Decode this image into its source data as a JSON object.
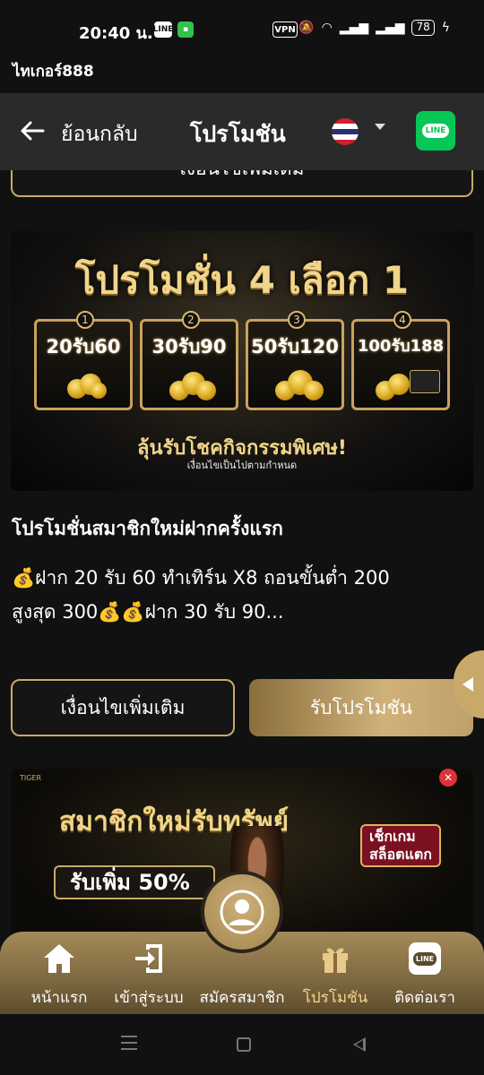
{
  "status_bar": {
    "time": "20:40 น.",
    "line_icon": "LINE",
    "vpn": "VPN",
    "battery": "78"
  },
  "site_title": "ไทเกอร์888",
  "header": {
    "back_label": "ย้อนกลับ",
    "title": "โปรโมชัน",
    "line_badge": "LINE"
  },
  "top_button": {
    "label": "เงื่อนไขเพิ่มเติม"
  },
  "banner1": {
    "title": "โปรโมชั่น 4 เลือก 1",
    "options": [
      {
        "num": "1",
        "label": "20รับ60"
      },
      {
        "num": "2",
        "label": "30รับ90"
      },
      {
        "num": "3",
        "label": "50รับ120"
      },
      {
        "num": "4",
        "label": "100รับ188"
      }
    ],
    "subtitle": "ลุ้นรับโชคกิจกรรมพิเศษ!",
    "small": "เงื่อนไขเป็นไปตามกำหนด"
  },
  "promo": {
    "title": "โปรโมชั่นสมาชิกใหม่ฝากครั้งแรก",
    "desc_line1": "💰ฝาก 20 รับ 60 ทำเทิร์น X8 ถอนขั้นต่ำ 200",
    "desc_line2": "สูงสุด 300💰💰ฝาก 30 รับ 90..."
  },
  "buttons": {
    "conditions": "เงื่อนไขเพิ่มเติม",
    "claim": "รับโปรโมชัน"
  },
  "banner2": {
    "logo": "TIGER",
    "title": "สมาชิกใหม่รับทรัพย์",
    "slot_line1": "เช็กเกม",
    "slot_line2": "สล็อตแตก",
    "pill": "รับเพิ่ม 50%",
    "close": "✕"
  },
  "bottom_nav": [
    {
      "label": "หน้าแรก",
      "icon": "home-icon"
    },
    {
      "label": "เข้าสู่ระบบ",
      "icon": "login-icon"
    },
    {
      "label": "สมัครสมาชิก",
      "icon": "avatar-icon"
    },
    {
      "label": "โปรโมชัน",
      "icon": "gift-icon"
    },
    {
      "label": "ติดต่อเรา",
      "icon": "line-icon"
    }
  ],
  "colors": {
    "gold": "#c9a96a",
    "background": "#111111",
    "line_green": "#06c755"
  }
}
